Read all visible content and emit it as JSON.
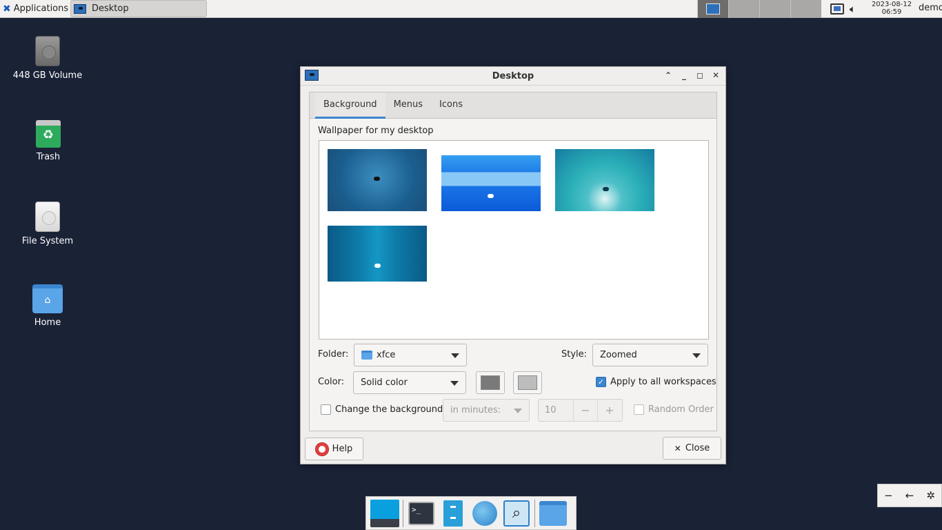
{
  "top_panel": {
    "applications_label": "Applications",
    "window_button_label": "Desktop",
    "clock_date": "2023-08-12",
    "clock_time": "06:59",
    "user": "demo"
  },
  "desktop_icons": [
    {
      "label": "448 GB Volume",
      "icon": "drive-harddisk-icon"
    },
    {
      "label": "Trash",
      "icon": "trash-icon"
    },
    {
      "label": "File System",
      "icon": "filesystem-icon"
    },
    {
      "label": "Home",
      "icon": "home-folder-icon"
    }
  ],
  "dialog": {
    "title": "Desktop",
    "tabs": [
      "Background",
      "Menus",
      "Icons"
    ],
    "active_tab": "Background",
    "wallpaper_label": "Wallpaper for my desktop",
    "folder_label": "Folder:",
    "folder_value": "xfce",
    "style_label": "Style:",
    "style_value": "Zoomed",
    "color_label": "Color:",
    "color_value": "Solid color",
    "color1": "#7a7a7a",
    "color2": "#bdbdbd",
    "apply_all_label": "Apply to all workspaces",
    "apply_all_checked": true,
    "change_bg_label": "Change the background",
    "change_bg_checked": false,
    "interval_unit": "in minutes:",
    "interval_value": "10",
    "random_order_label": "Random Order",
    "help_label": "Help",
    "close_label": "Close"
  },
  "dock": {
    "items": [
      "show-desktop-icon",
      "terminal-icon",
      "file-manager-icon",
      "web-browser-icon",
      "app-finder-icon",
      "folder-icon"
    ]
  },
  "colors": {
    "desktop_bg": "#1a2236",
    "accent": "#3b86d0"
  }
}
